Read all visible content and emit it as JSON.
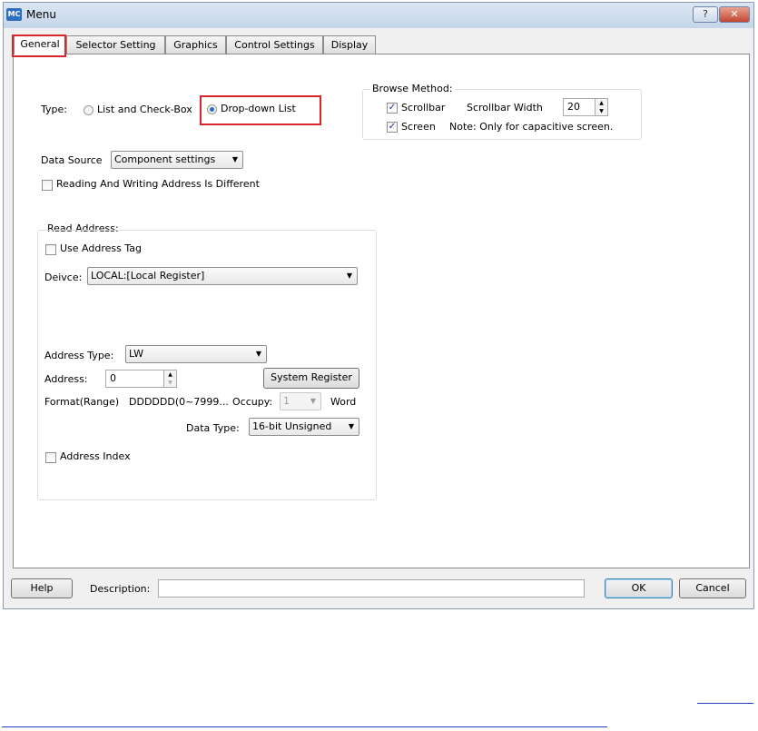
{
  "window": {
    "title": "Menu",
    "app_icon": "MC",
    "help_button": "?",
    "close_button": "✕"
  },
  "tabs": [
    {
      "label": "General"
    },
    {
      "label": "Selector Setting"
    },
    {
      "label": "Graphics"
    },
    {
      "label": "Control Settings"
    },
    {
      "label": "Display"
    }
  ],
  "general": {
    "type_label": "Type:",
    "type_options": [
      {
        "label": "List and Check-Box",
        "selected": false
      },
      {
        "label": "Drop-down List",
        "selected": true
      }
    ],
    "data_source_label": "Data Source",
    "data_source_value": "Component settings",
    "rw_address_different_label": "Reading And Writing Address Is Different",
    "rw_address_different_checked": false,
    "browse_method": {
      "title": "Browse Method:",
      "scrollbar_label": "Scrollbar",
      "scrollbar_checked": true,
      "scrollbar_width_label": "Scrollbar Width",
      "scrollbar_width_value": "20",
      "screen_label": "Screen",
      "screen_checked": true,
      "note": "Note: Only for capacitive screen."
    },
    "read_address": {
      "title": "Read Address:",
      "use_address_tag_label": "Use Address Tag",
      "use_address_tag_checked": false,
      "device_label": "Deivce:",
      "device_value": "LOCAL:[Local Register]",
      "address_type_label": "Address Type:",
      "address_type_value": "LW",
      "address_label": "Address:",
      "address_value": "0",
      "system_register_button": "System Register",
      "format_label": "Format(Range)",
      "format_value": "DDDDDD(0~7999...",
      "occupy_label": "Occupy:",
      "occupy_value": "1",
      "occupy_unit": "Word",
      "data_type_label": "Data Type:",
      "data_type_value": "16-bit Unsigned",
      "address_index_label": "Address Index",
      "address_index_checked": false
    }
  },
  "footer": {
    "help_button": "Help",
    "description_label": "Description:",
    "description_value": "",
    "ok_button": "OK",
    "cancel_button": "Cancel"
  },
  "colors": {
    "highlight_box": "#d9262c",
    "hyperlink_underline": "#1f3fbf"
  }
}
